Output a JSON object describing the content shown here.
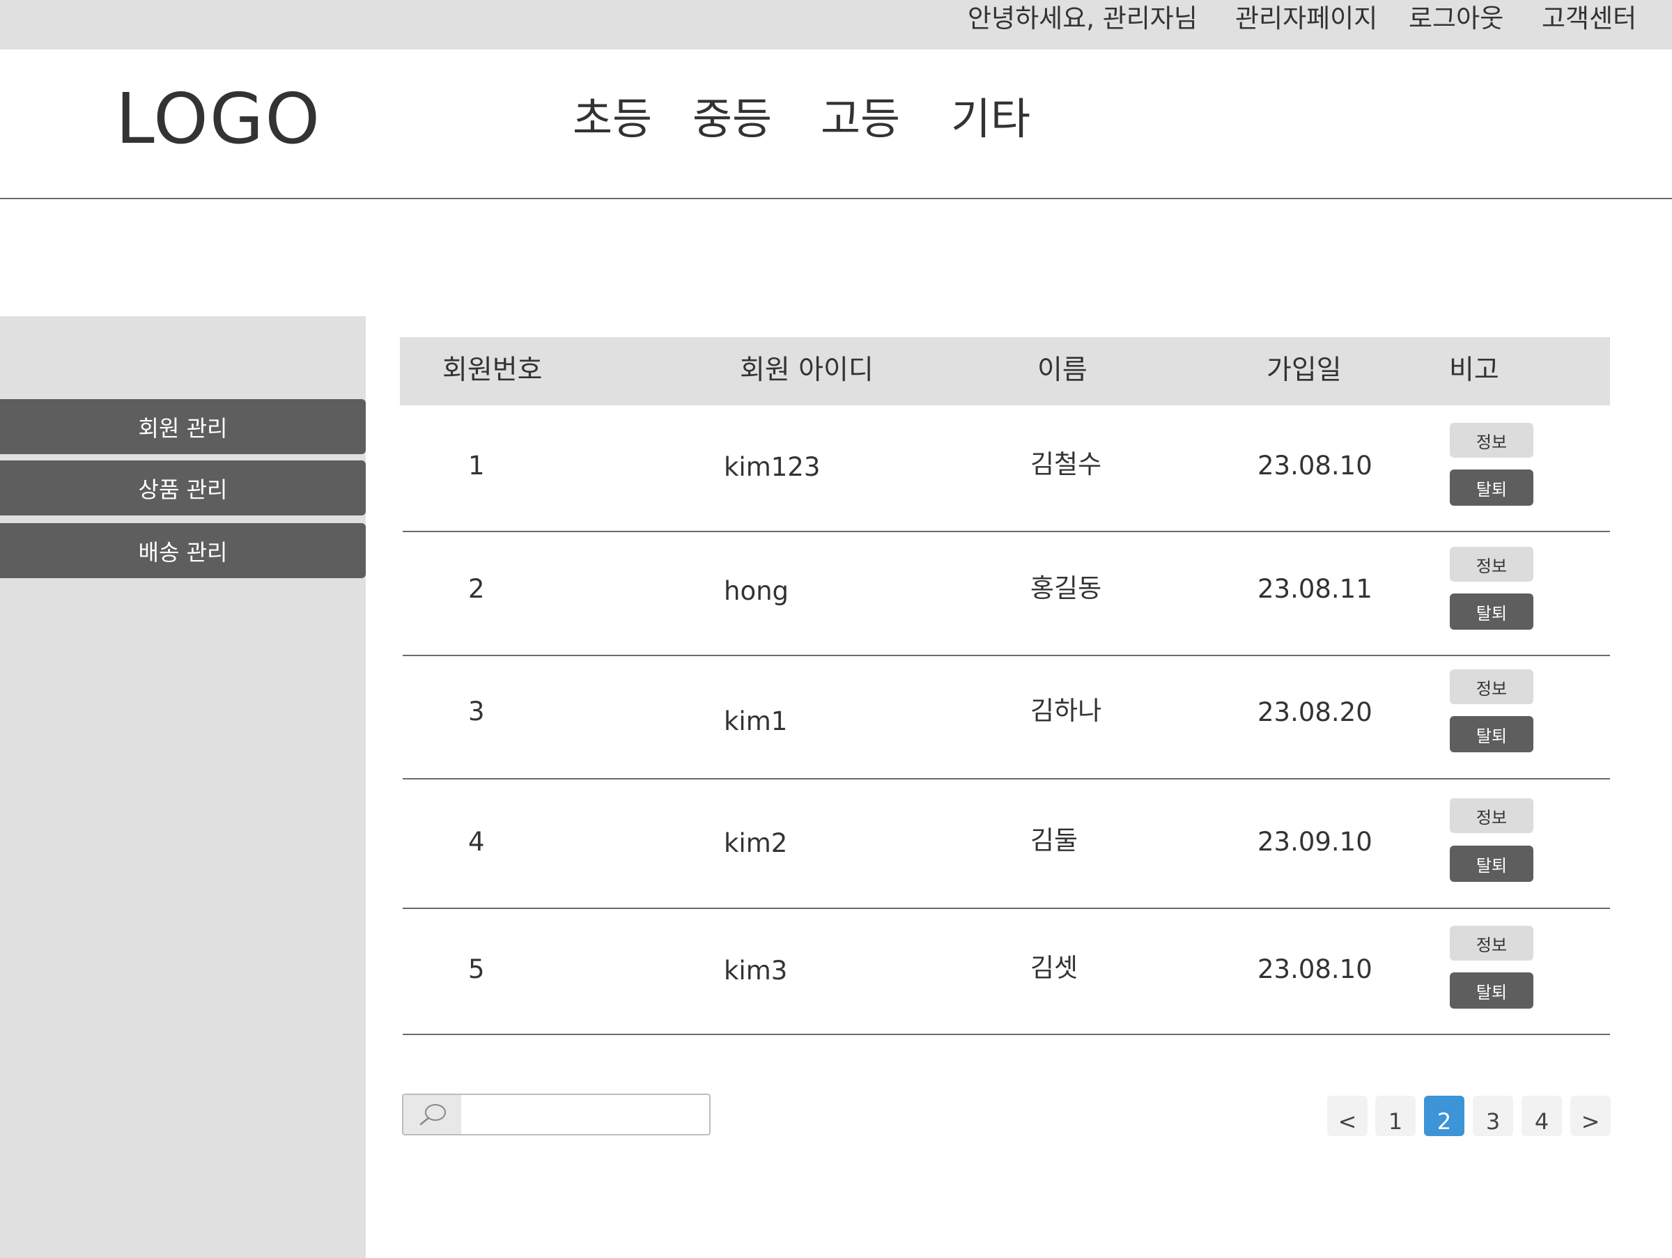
{
  "topbar": {
    "greeting": "안녕하세요, 관리자님",
    "admin_page": "관리자페이지",
    "logout": "로그아웃",
    "customer_center": "고객센터"
  },
  "header": {
    "logo": "LOGO",
    "nav": [
      "초등",
      "중등",
      "고등",
      "기타"
    ]
  },
  "sidebar": {
    "items": [
      "회원 관리",
      "상품 관리",
      "배송 관리"
    ]
  },
  "table": {
    "headers": [
      "회원번호",
      "회원 아이디",
      "이름",
      "가입일",
      "비고"
    ],
    "info_label": "정보",
    "withdraw_label": "탈퇴",
    "rows": [
      {
        "no": "1",
        "id": "kim123",
        "name": "김철수",
        "date": "23.08.10"
      },
      {
        "no": "2",
        "id": "hong",
        "name": "홍길동",
        "date": "23.08.11"
      },
      {
        "no": "3",
        "id": "kim1",
        "name": "김하나",
        "date": "23.08.20"
      },
      {
        "no": "4",
        "id": "kim2",
        "name": "김둘",
        "date": "23.09.10"
      },
      {
        "no": "5",
        "id": "kim3",
        "name": "김셋",
        "date": "23.08.10"
      }
    ]
  },
  "search": {
    "icon": "search-icon",
    "value": "",
    "placeholder": ""
  },
  "pagination": {
    "prev": "<",
    "pages": [
      "1",
      "2",
      "3",
      "4"
    ],
    "current": "2",
    "next": ">"
  },
  "colors": {
    "topbar_bg": "#e0e0e0",
    "sidebar_bg": "#e0e0e0",
    "button_dark": "#5e5e5e",
    "page_active": "#3d94d6"
  }
}
